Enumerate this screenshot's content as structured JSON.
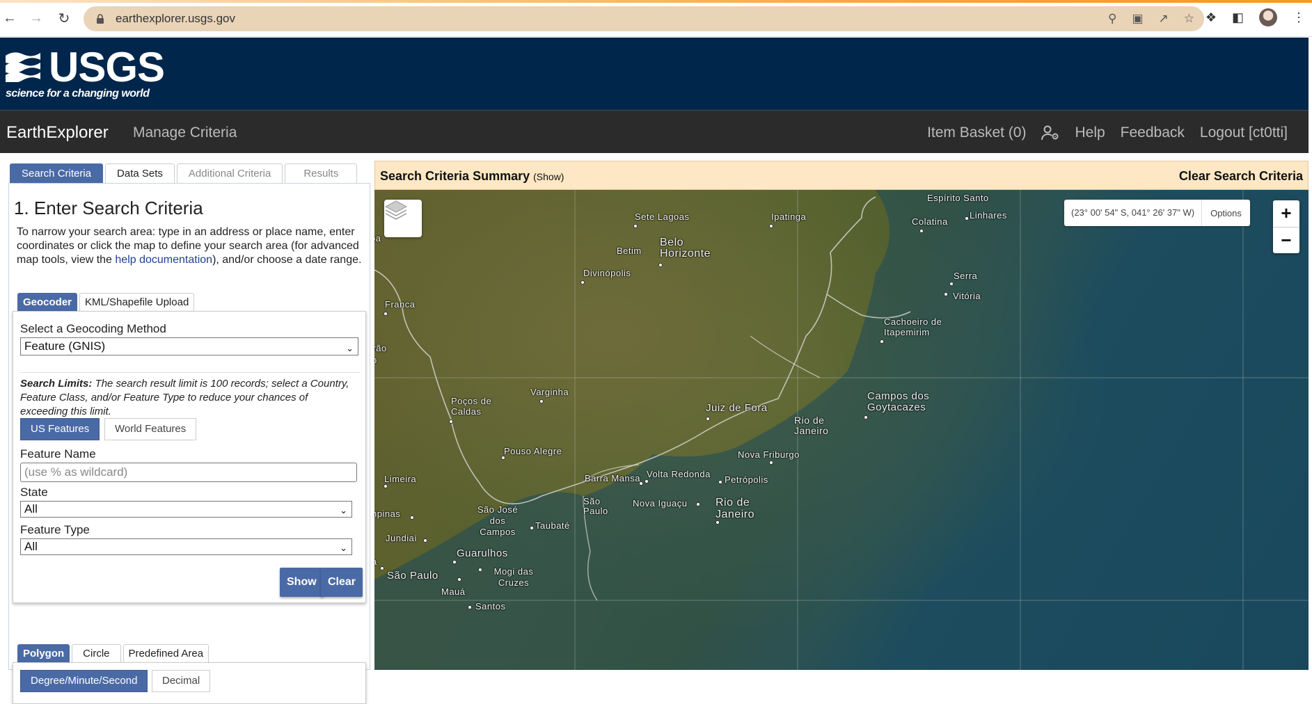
{
  "browser": {
    "url": "earthexplorer.usgs.gov"
  },
  "banner": {
    "logo_text": "USGS",
    "tagline": "science for a changing world"
  },
  "navbar": {
    "brand": "EarthExplorer",
    "manage": "Manage Criteria",
    "item_basket": "Item Basket (0)",
    "help": "Help",
    "feedback": "Feedback",
    "logout": "Logout [ct0tti]"
  },
  "left": {
    "tabs": [
      "Search Criteria",
      "Data Sets",
      "Additional Criteria",
      "Results"
    ],
    "heading": "1. Enter Search Criteria",
    "intro_pre": "To narrow your search area: type in an address or place name, enter coordinates or click the map to define your search area (for advanced map tools, view the ",
    "intro_link": "help documentation",
    "intro_post": "), and/or choose a date range.",
    "subtabs": [
      "Geocoder",
      "KML/Shapefile Upload"
    ],
    "geocoding_label": "Select a Geocoding Method",
    "geocoding_value": "Feature (GNIS)",
    "limits_bold": "Search Limits:",
    "limits_text": " The search result limit is 100 records; select a Country, Feature Class, and/or Feature Type to reduce your chances of exceeding this limit.",
    "feature_toggle": [
      "US Features",
      "World Features"
    ],
    "feature_name_label": "Feature Name",
    "feature_name_placeholder": "(use % as wildcard)",
    "state_label": "State",
    "state_value": "All",
    "feature_type_label": "Feature Type",
    "feature_type_value": "All",
    "show_btn": "Show",
    "clear_btn": "Clear",
    "shape_tabs": [
      "Polygon",
      "Circle",
      "Predefined Area"
    ],
    "coord_toggle": [
      "Degree/Minute/Second",
      "Decimal"
    ]
  },
  "summary": {
    "title": "Search Criteria Summary",
    "show": "(Show)",
    "clear": "Clear Search Criteria"
  },
  "map": {
    "coordinates": "(23° 00' 54\" S, 041° 26' 37\" W)",
    "options": "Options",
    "zoom_in": "+",
    "zoom_out": "−",
    "cities": {
      "sete_lagoas": "Sete Lagoas",
      "ipatinga": "Ipatinga",
      "espirito_santo": "Espírito Santo",
      "linhares": "Linhares",
      "colatina": "Colatina",
      "belo_horizonte": "Belo Horizonte",
      "betim": "Betim",
      "divinopolis": "Divinópolis",
      "serra": "Serra",
      "vitoria": "Vitória",
      "franca": "Franca",
      "cachoeiro": "Cachoeiro de Itapemirim",
      "irao": "irão",
      "varginha": "Varginha",
      "pocos_de_caldas": "Poços de Caldas",
      "campos": "Campos dos Goytacazes",
      "juiz_de_fora": "Juiz de Fora",
      "rio_de_janeiro_state": "Rio de Janeiro",
      "pouso_alegre": "Pouso Alegre",
      "nova_friburgo": "Nova Friburgo",
      "limeira": "Limeira",
      "barra_mansa": "Barra Mansa",
      "volta_redonda": "Volta Redonda",
      "petropolis": "Petrópolis",
      "sao_paulo_state": "São Paulo",
      "nova_iguacu": "Nova Iguaçu",
      "rio_de_janeiro_city": "Rio de Janeiro",
      "campinas": "npinas",
      "sao_jose": "São José dos Campos",
      "taubate": "Taubaté",
      "jundiai": "Jundiaí",
      "guarulhos": "Guarulhos",
      "sao_paulo_city": "São Paulo",
      "mogi": "Mogi das Cruzes",
      "maua": "Mauá",
      "santos": "Santos",
      "a_left": "a",
      "ba_left": "ba",
      "o_left": "o"
    }
  }
}
